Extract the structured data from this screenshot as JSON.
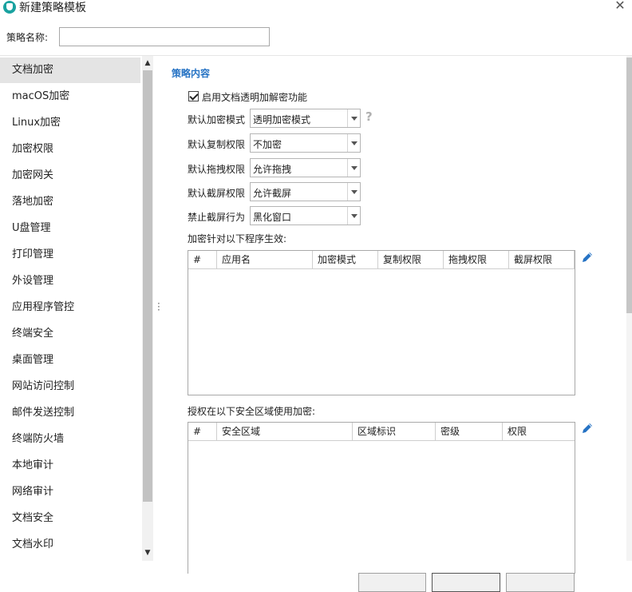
{
  "window": {
    "title": "新建策略模板",
    "close_glyph": "✕"
  },
  "policy_name": {
    "label": "策略名称:",
    "value": ""
  },
  "sidebar": {
    "items": [
      {
        "label": "文档加密",
        "active": true
      },
      {
        "label": "macOS加密"
      },
      {
        "label": "Linux加密"
      },
      {
        "label": "加密权限"
      },
      {
        "label": "加密网关"
      },
      {
        "label": "落地加密"
      },
      {
        "label": "U盘管理"
      },
      {
        "label": "打印管理"
      },
      {
        "label": "外设管理"
      },
      {
        "label": "应用程序管控"
      },
      {
        "label": "终端安全"
      },
      {
        "label": "桌面管理"
      },
      {
        "label": "网站访问控制"
      },
      {
        "label": "邮件发送控制"
      },
      {
        "label": "终端防火墙"
      },
      {
        "label": "本地审计"
      },
      {
        "label": "网络审计"
      },
      {
        "label": "文档安全"
      },
      {
        "label": "文档水印"
      }
    ]
  },
  "content": {
    "section_title": "策略内容",
    "enable_checkbox": {
      "label": "启用文档透明加解密功能",
      "checked": true
    },
    "fields": [
      {
        "label": "默认加密模式",
        "value": "透明加密模式"
      },
      {
        "label": "默认复制权限",
        "value": "不加密"
      },
      {
        "label": "默认拖拽权限",
        "value": "允许拖拽"
      },
      {
        "label": "默认截屏权限",
        "value": "允许截屏"
      },
      {
        "label": "禁止截屏行为",
        "value": "黑化窗口"
      }
    ],
    "help_glyph": "?",
    "program_table": {
      "caption": "加密针对以下程序生效:",
      "columns": [
        "#",
        "应用名",
        "加密模式",
        "复制权限",
        "拖拽权限",
        "截屏权限"
      ],
      "rows": []
    },
    "zone_table": {
      "caption": "授权在以下安全区域使用加密:",
      "columns": [
        "#",
        "安全区域",
        "区域标识",
        "密级",
        "权限"
      ],
      "rows": []
    }
  },
  "colors": {
    "accent": "#2673c4",
    "active_item": "#e4e4e4",
    "app_icon": "#1aa2a0"
  },
  "icons": [
    "app-logo-icon",
    "close-icon",
    "help-icon",
    "edit-pencil-icon",
    "scroll-up-icon",
    "scroll-down-icon",
    "splitter-grip-icon"
  ]
}
